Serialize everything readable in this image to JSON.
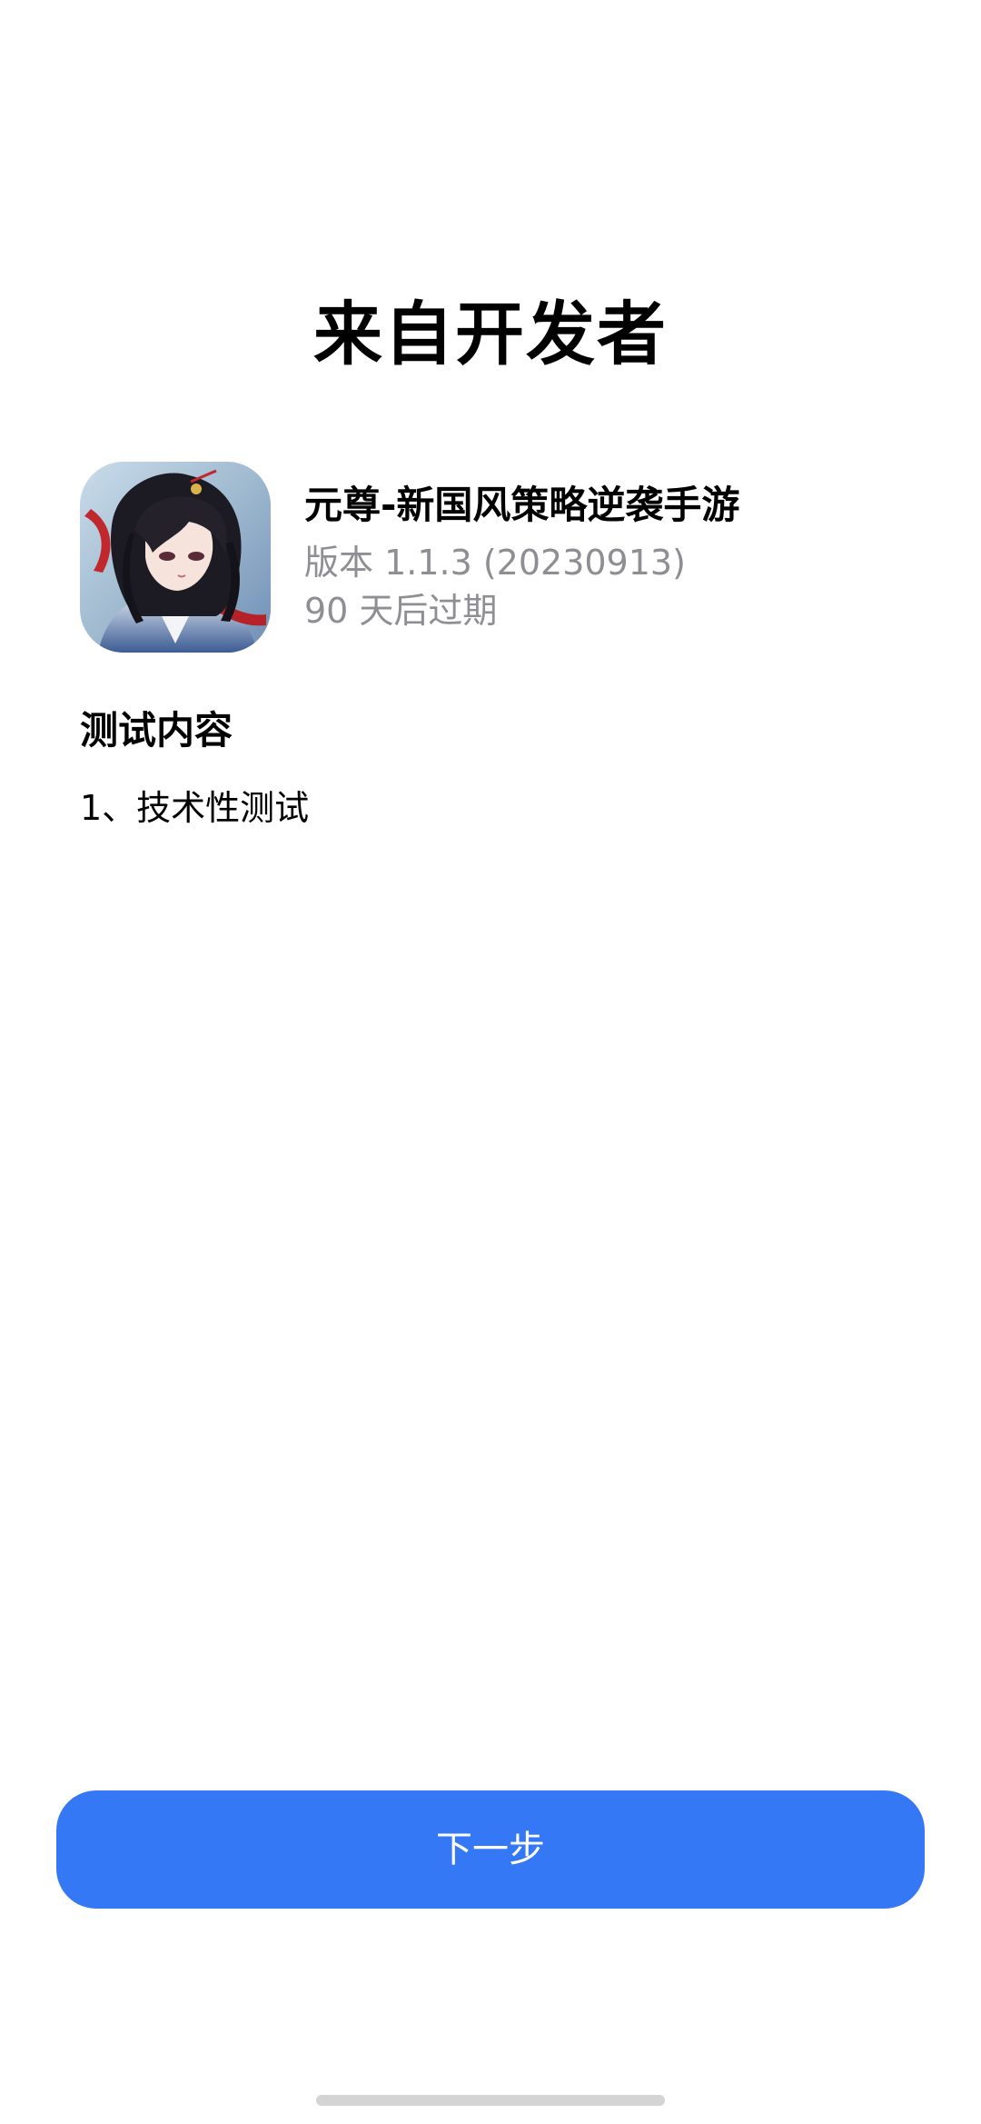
{
  "header": {
    "title": "来自开发者"
  },
  "app": {
    "icon": "app-icon",
    "name": "元尊-新国风策略逆袭手游",
    "version": "版本 1.1.3 (20230913)",
    "expiry": "90 天后过期"
  },
  "test_section": {
    "heading": "测试内容",
    "body": "1、技术性测试"
  },
  "actions": {
    "next_label": "下一步"
  },
  "colors": {
    "accent": "#3478f6",
    "secondary_text": "#8e8e93",
    "background": "#ffffff",
    "home_indicator": "#d4d4d4"
  }
}
